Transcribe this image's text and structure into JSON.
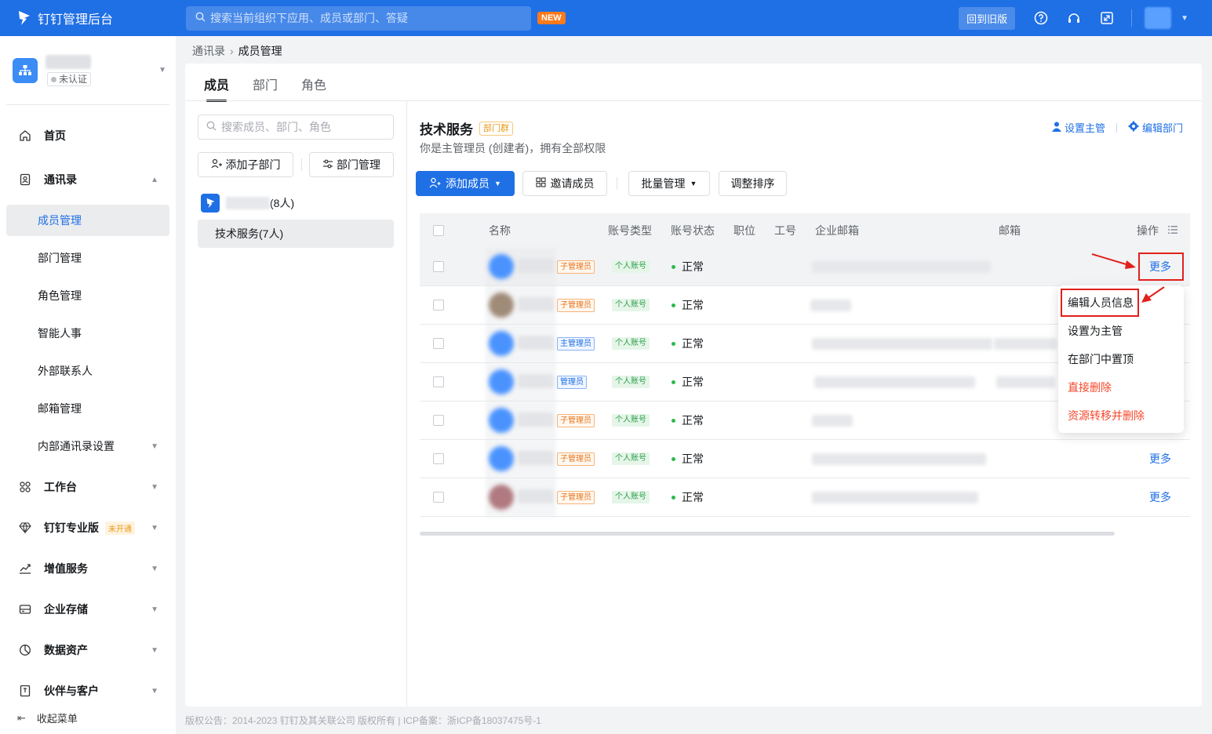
{
  "topbar": {
    "app_title": "钉钉管理后台",
    "search_placeholder": "搜索当前组织下应用、成员或部门、答疑",
    "new_badge": "NEW",
    "old_version_label": "回到旧版",
    "icons": [
      "help-icon",
      "headset-icon",
      "fullscreen-icon"
    ]
  },
  "sidebar": {
    "org_badge": "未认证",
    "items": [
      {
        "label": "首页",
        "icon": "home-icon"
      },
      {
        "label": "通讯录",
        "icon": "contacts-icon"
      },
      {
        "label": "成员管理"
      },
      {
        "label": "部门管理"
      },
      {
        "label": "角色管理"
      },
      {
        "label": "智能人事"
      },
      {
        "label": "外部联系人"
      },
      {
        "label": "邮箱管理"
      },
      {
        "label": "内部通讯录设置"
      },
      {
        "label": "工作台",
        "icon": "grid-icon"
      },
      {
        "label": "钉钉专业版",
        "icon": "diamond-icon",
        "badge": "未开通"
      },
      {
        "label": "增值服务",
        "icon": "trend-icon"
      },
      {
        "label": "企业存储",
        "icon": "storage-icon"
      },
      {
        "label": "数据资产",
        "icon": "pie-icon"
      },
      {
        "label": "伙伴与客户",
        "icon": "partner-icon"
      }
    ],
    "collapse_label": "收起菜单"
  },
  "breadcrumb": {
    "parent": "通讯录",
    "current": "成员管理"
  },
  "tabs": [
    "成员",
    "部门",
    "角色"
  ],
  "dept_panel": {
    "search_placeholder": "搜索成员、部门、角色",
    "add_sub_label": "添加子部门",
    "manage_label": "部门管理",
    "root_count": "(8人)",
    "selected_dept": "技术服务(7人)"
  },
  "dept_header": {
    "title": "技术服务",
    "badge": "部门群",
    "subtitle": "你是主管理员 (创建者)，拥有全部权限",
    "set_manager": "设置主管",
    "edit_dept": "编辑部门"
  },
  "toolbar": {
    "add_member": "添加成员",
    "invite": "邀请成员",
    "batch": "批量管理",
    "sort": "调整排序"
  },
  "table": {
    "columns": [
      "名称",
      "账号类型",
      "账号状态",
      "职位",
      "工号",
      "企业邮箱",
      "邮箱",
      "操作"
    ],
    "rows": [
      {
        "role": "子管理员",
        "role_type": "sub",
        "account": "个人账号",
        "status": "正常",
        "more": "更多",
        "avatar_color": "#4a93ff"
      },
      {
        "role": "子管理员",
        "role_type": "sub",
        "account": "个人账号",
        "status": "正常",
        "more": "",
        "avatar_color": "#a08a78"
      },
      {
        "role": "主管理员",
        "role_type": "main",
        "account": "个人账号",
        "status": "正常",
        "more": "",
        "avatar_color": "#4a93ff"
      },
      {
        "role": "管理员",
        "role_type": "main",
        "account": "个人账号",
        "status": "正常",
        "more": "",
        "avatar_color": "#4a93ff"
      },
      {
        "role": "子管理员",
        "role_type": "sub",
        "account": "个人账号",
        "status": "正常",
        "more": "",
        "avatar_color": "#4a93ff"
      },
      {
        "role": "子管理员",
        "role_type": "sub",
        "account": "个人账号",
        "status": "正常",
        "more": "更多",
        "avatar_color": "#4a93ff"
      },
      {
        "role": "子管理员",
        "role_type": "sub",
        "account": "个人账号",
        "status": "正常",
        "more": "更多",
        "avatar_color": "#b07a80"
      }
    ]
  },
  "dropdown": {
    "items": [
      "编辑人员信息",
      "设置为主管",
      "在部门中置顶",
      "直接删除",
      "资源转移并删除"
    ]
  },
  "footer": "版权公告：2014-2023 钉钉及其关联公司 版权所有 | ICP备案：浙ICP备18037475号-1"
}
